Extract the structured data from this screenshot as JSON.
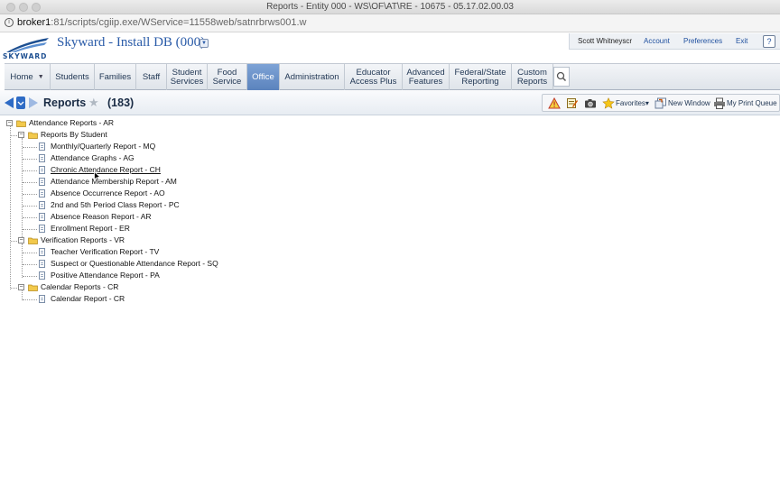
{
  "browser": {
    "window_title": "Reports - Entity 000 - WS\\OF\\AT\\RE - 10675 - 05.17.02.00.03",
    "url_host": "broker1",
    "url_path": ":81/scripts/cgiip.exe/WService=11558web/satnrbrws001.w"
  },
  "header": {
    "logo_text": "SKYWARD",
    "app_title": "Skyward - Install DB (000)",
    "user_name": "Scott Whitneyscr",
    "account_label": "Account",
    "preferences_label": "Preferences",
    "exit_label": "Exit",
    "help_label": "?"
  },
  "nav": {
    "tabs": [
      {
        "label": "Home",
        "has_menu": true,
        "active": false
      },
      {
        "label": "Students",
        "active": false
      },
      {
        "label": "Families",
        "active": false
      },
      {
        "label": "Staff",
        "active": false
      },
      {
        "label": "Student\nServices",
        "active": false
      },
      {
        "label": "Food\nService",
        "active": false
      },
      {
        "label": "Office",
        "active": true
      },
      {
        "label": "Administration",
        "active": false
      },
      {
        "label": "Educator\nAccess Plus",
        "active": false
      },
      {
        "label": "Advanced\nFeatures",
        "active": false
      },
      {
        "label": "Federal/State\nReporting",
        "active": false
      },
      {
        "label": "Custom\nReports",
        "active": false
      }
    ],
    "search_icon": "magnifier-icon"
  },
  "reports_bar": {
    "title": "Reports",
    "count": "(183)",
    "favorites_label": "Favorites",
    "new_window_label": "New Window",
    "print_queue_label": "My Print Queue"
  },
  "tree": {
    "root": {
      "label": "Attendance Reports - AR"
    },
    "groups": [
      {
        "label": "Reports By Student",
        "items": [
          "Monthly/Quarterly Report - MQ",
          "Attendance Graphs - AG",
          "Chronic Attendance Report - CH",
          "Attendance Membership Report - AM",
          "Absence Occurrence Report - AO",
          "2nd and 5th Period Class Report - PC",
          "Absence Reason Report - AR",
          "Enrollment Report - ER"
        ]
      },
      {
        "label": "Verification Reports - VR",
        "items": [
          "Teacher Verification Report - TV",
          "Suspect or Questionable Attendance Report - SQ",
          "Positive Attendance Report - PA"
        ]
      },
      {
        "label": "Calendar Reports - CR",
        "items": [
          "Calendar Report - CR"
        ]
      }
    ]
  },
  "colors": {
    "brand_blue": "#2a5ba8",
    "active_tab": "#5b83bd",
    "folder_yellow": "#f2c94c"
  }
}
